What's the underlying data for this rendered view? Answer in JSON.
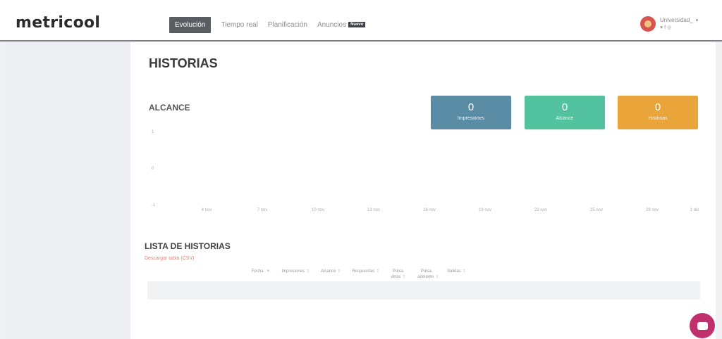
{
  "header": {
    "logo": "metricool",
    "nav": [
      {
        "label": "Evolución",
        "active": true
      },
      {
        "label": "Tiempo real"
      },
      {
        "label": "Planificación"
      },
      {
        "label": "Anuncios",
        "badge": "Nuevo"
      }
    ],
    "user": {
      "name": "Universidad_",
      "caret": "▾",
      "socials": "♥f◎"
    }
  },
  "page": {
    "title": "HISTORIAS"
  },
  "chart": {
    "section_title": "ALCANCE",
    "y_ticks": [
      "1",
      "0",
      "-1"
    ],
    "x_ticks": [
      "4 nov",
      "7 nov",
      "10 nov",
      "13 nov",
      "16 nov",
      "19 nov",
      "22 nov",
      "25 nov",
      "28 nov",
      "1 dic"
    ]
  },
  "stats": [
    {
      "value": "0",
      "label": "Impresiones",
      "color": "#5b8ca5"
    },
    {
      "value": "0",
      "label": "Alcance",
      "color": "#52c39e"
    },
    {
      "value": "0",
      "label": "Historias",
      "color": "#e9a43a"
    }
  ],
  "list": {
    "title": "LISTA DE HISTORIAS",
    "download": "Descargar tabla (CSV)",
    "columns": [
      {
        "label": "Fecha",
        "sort": "▼"
      },
      {
        "label": "Impresiones",
        "sort": "⇕"
      },
      {
        "label": "Alcance",
        "sort": "⇕"
      },
      {
        "label": "Respuestas",
        "sort": "⇕"
      },
      {
        "label": "Pulsa. atrás",
        "sort": "⇕"
      },
      {
        "label": "Pulsa. adelante",
        "sort": "⇕"
      },
      {
        "label": "Salidas",
        "sort": "⇕"
      }
    ]
  }
}
